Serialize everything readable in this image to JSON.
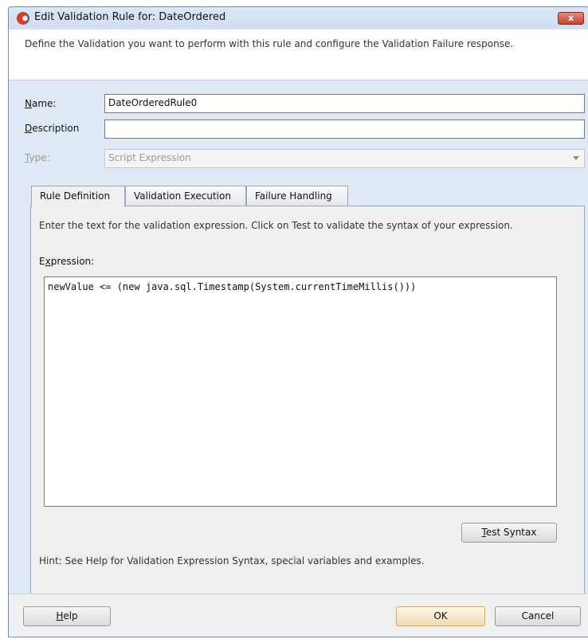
{
  "window": {
    "title": "Edit Validation Rule for: DateOrdered",
    "close_label": "x"
  },
  "intro": "Define the Validation you want to perform with this rule and configure the Validation Failure response.",
  "form": {
    "name_label": "Name:",
    "name_value": "DateOrderedRule0",
    "description_label": "Description",
    "description_value": "",
    "type_label": "Type:",
    "type_value": "Script Expression"
  },
  "tabs": [
    {
      "label": "Rule Definition",
      "active": true
    },
    {
      "label": "Validation Execution",
      "active": false
    },
    {
      "label": "Failure Handling",
      "active": false
    }
  ],
  "rule_definition": {
    "intro": "Enter the text for the validation expression. Click on Test to validate the syntax of your expression.",
    "expression_label": "Expression:",
    "expression_value": "newValue <= (new java.sql.Timestamp(System.currentTimeMillis()))",
    "test_button": "Test Syntax",
    "hint": "Hint: See Help for Validation Expression Syntax, special variables and examples."
  },
  "footer": {
    "help_button": "Help",
    "ok_button": "OK",
    "cancel_button": "Cancel"
  },
  "colors": {
    "title_bar": "#d4e2f2",
    "close_button": "#c7422a",
    "ok_border": "#e5a345"
  },
  "icons": {
    "app": "oracle-jdeveloper-icon",
    "close": "close-icon",
    "dropdown": "chevron-down-icon"
  }
}
